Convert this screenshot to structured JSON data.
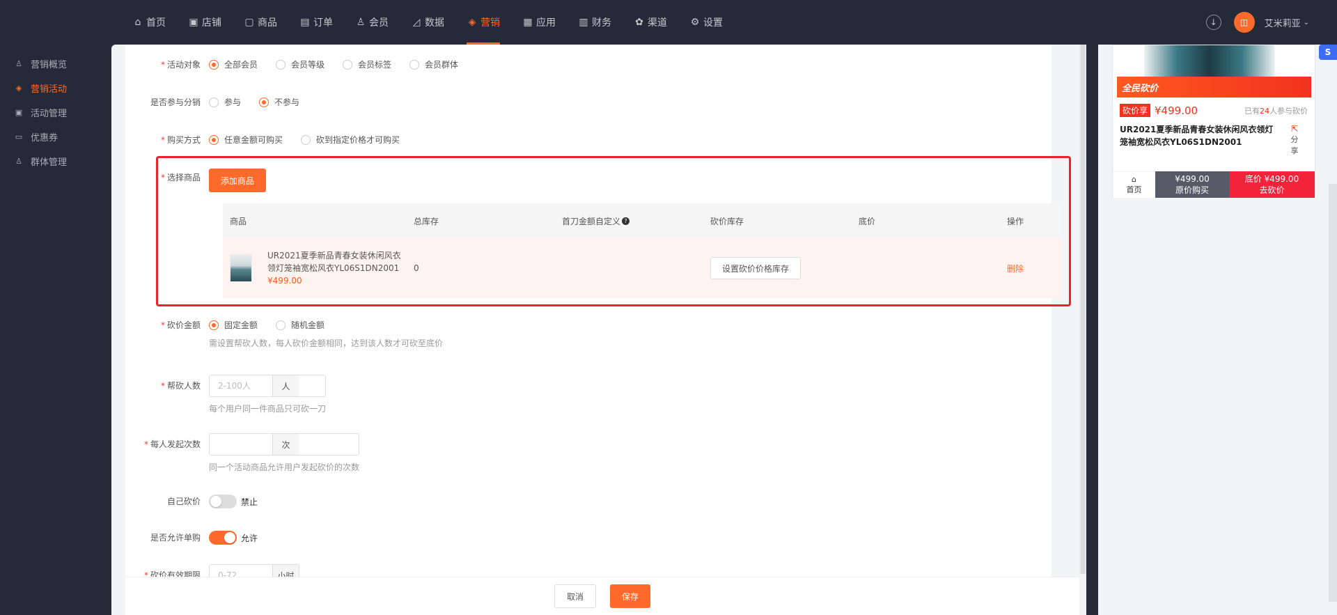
{
  "nav": {
    "items": [
      {
        "label": "首页",
        "icon": "home-icon"
      },
      {
        "label": "店铺",
        "icon": "shop-icon"
      },
      {
        "label": "商品",
        "icon": "goods-icon"
      },
      {
        "label": "订单",
        "icon": "order-icon"
      },
      {
        "label": "会员",
        "icon": "member-icon"
      },
      {
        "label": "数据",
        "icon": "chart-icon"
      },
      {
        "label": "营销",
        "icon": "tag-icon",
        "active": true
      },
      {
        "label": "应用",
        "icon": "app-icon"
      },
      {
        "label": "财务",
        "icon": "finance-icon"
      },
      {
        "label": "渠道",
        "icon": "channel-icon"
      },
      {
        "label": "设置",
        "icon": "gear-icon"
      }
    ],
    "user_name": "艾米莉亚",
    "accent": "#ff6a2c"
  },
  "sidebar": {
    "items": [
      {
        "label": "营销概览"
      },
      {
        "label": "营销活动",
        "active": true
      },
      {
        "label": "活动管理"
      },
      {
        "label": "优惠券"
      },
      {
        "label": "群体管理"
      }
    ]
  },
  "form": {
    "target": {
      "label": "活动对象",
      "options": [
        "全部会员",
        "会员等级",
        "会员标签",
        "会员群体"
      ],
      "selected": 0
    },
    "distribution": {
      "label": "是否参与分销",
      "options": [
        "参与",
        "不参与"
      ],
      "selected": 1
    },
    "purchase": {
      "label": "购买方式",
      "options": [
        "任意金额可购买",
        "砍到指定价格才可购买"
      ],
      "selected": 0
    },
    "goods": {
      "label": "选择商品",
      "add_button": "添加商品",
      "columns": [
        "商品",
        "总库存",
        "首刀金额自定义",
        "砍价库存",
        "底价",
        "操作"
      ],
      "rows": [
        {
          "name": "UR2021夏季新品青春女装休闲风衣领灯笼袖宽松风衣YL06S1DN2001",
          "price": "¥499.00",
          "stock": "0",
          "set_button": "设置砍价价格库存",
          "delete": "删除"
        }
      ]
    },
    "amount": {
      "label": "砍价金额",
      "options": [
        "固定金额",
        "随机金额"
      ],
      "selected": 0,
      "hint": "需设置帮砍人数，每人砍价金额相同，达到该人数才可砍至底价"
    },
    "helpers": {
      "label": "帮砍人数",
      "placeholder": "2-100人",
      "unit": "人",
      "hint": "每个用户同一件商品只可砍一刀"
    },
    "launches": {
      "label": "每人发起次数",
      "placeholder": "",
      "unit": "次",
      "hint": "同一个活动商品允许用户发起砍价的次数"
    },
    "self_cut": {
      "label": "自己砍价",
      "state": "禁止"
    },
    "single_buy": {
      "label": "是否允许单购",
      "state": "允许"
    },
    "validity": {
      "label": "砍价有效期限",
      "placeholder": "0-72",
      "unit": "小时"
    }
  },
  "footer": {
    "cancel": "取消",
    "save": "保存"
  },
  "preview": {
    "banner": "全民砍价",
    "tag": "砍价享",
    "price": "¥499.00",
    "joined_prefix": "已有",
    "joined_count": "24",
    "joined_suffix": "人参与砍价",
    "title": "UR2021夏季新品青春女装休闲风衣领灯笼袖宽松风衣YL06S1DN2001",
    "share": "分享",
    "home": "首页",
    "orig_price": "¥499.00",
    "orig_label": "原价购买",
    "cut_price": "底价 ¥499.00",
    "cut_label": "去砍价"
  }
}
